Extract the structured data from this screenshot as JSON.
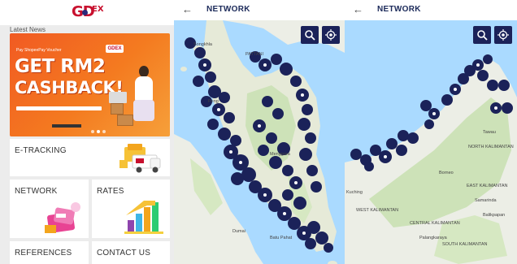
{
  "home": {
    "logo": {
      "brand": "GDEX"
    },
    "latest_news_label": "Latest News",
    "banner": {
      "topline": "Pay ShopeePay Voucher",
      "headline_line1": "GET RM2",
      "headline_line2": "CASHBACK!"
    },
    "tiles": {
      "etracking": "E-TRACKING",
      "network": "NETWORK",
      "rates": "RATES",
      "references": "REFERENCES",
      "contact": "CONTACT US"
    }
  },
  "network_west": {
    "title": "NETWORK",
    "labels": [
      "PATTANI",
      "Songkhla",
      "Peng",
      "Menggara",
      "Dumai",
      "Batu Pahat"
    ]
  },
  "network_east": {
    "title": "NETWORK",
    "labels": [
      "Tawau",
      "Borneo",
      "Kuching",
      "EAST KALIMANTAN",
      "WEST KALIMANTAN",
      "CENTRAL KALIMANTAN",
      "Samarinda",
      "SOUTH KALIMANTAN",
      "NORTH KALIMANTAN",
      "Palangkaraya",
      "Balikpapan"
    ]
  },
  "colors": {
    "brand_red": "#c8102e",
    "navy": "#1b2259",
    "sea": "#aadaff",
    "land": "#eceee6"
  },
  "icons": [
    "back-arrow-icon",
    "search-icon",
    "locate-icon",
    "map-pin-icon"
  ]
}
